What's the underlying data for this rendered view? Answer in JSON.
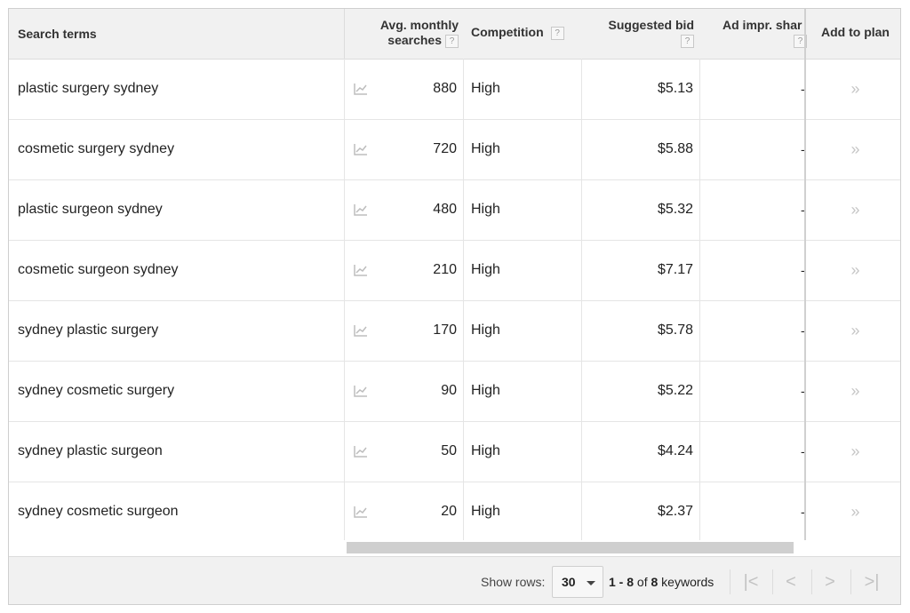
{
  "columns": {
    "search_terms": "Search terms",
    "avg_monthly_line1": "Avg. monthly",
    "avg_monthly_line2": "searches",
    "competition": "Competition",
    "suggested_bid": "Suggested bid",
    "ad_impr_share": "Ad impr. shar",
    "add_to_plan": "Add to plan",
    "help_glyph": "?"
  },
  "rows": [
    {
      "term": "plastic surgery sydney",
      "searches": "880",
      "competition": "High",
      "bid": "$5.13",
      "impr": "-",
      "add": "»"
    },
    {
      "term": "cosmetic surgery sydney",
      "searches": "720",
      "competition": "High",
      "bid": "$5.88",
      "impr": "-",
      "add": "»"
    },
    {
      "term": "plastic surgeon sydney",
      "searches": "480",
      "competition": "High",
      "bid": "$5.32",
      "impr": "-",
      "add": "»"
    },
    {
      "term": "cosmetic surgeon sydney",
      "searches": "210",
      "competition": "High",
      "bid": "$7.17",
      "impr": "-",
      "add": "»"
    },
    {
      "term": "sydney plastic surgery",
      "searches": "170",
      "competition": "High",
      "bid": "$5.78",
      "impr": "-",
      "add": "»"
    },
    {
      "term": "sydney cosmetic surgery",
      "searches": "90",
      "competition": "High",
      "bid": "$5.22",
      "impr": "-",
      "add": "»"
    },
    {
      "term": "sydney plastic surgeon",
      "searches": "50",
      "competition": "High",
      "bid": "$4.24",
      "impr": "-",
      "add": "»"
    },
    {
      "term": "sydney cosmetic surgeon",
      "searches": "20",
      "competition": "High",
      "bid": "$2.37",
      "impr": "-",
      "add": "»"
    }
  ],
  "footer": {
    "show_rows_label": "Show rows:",
    "rows_value": "30",
    "range_text": "1 - 8",
    "of_text": "of",
    "total": "8",
    "keywords_text": "keywords",
    "first_glyph": "|<",
    "prev_glyph": "<",
    "next_glyph": ">",
    "last_glyph": ">|"
  },
  "scrollbar": {
    "visible_fraction": 0.5
  }
}
